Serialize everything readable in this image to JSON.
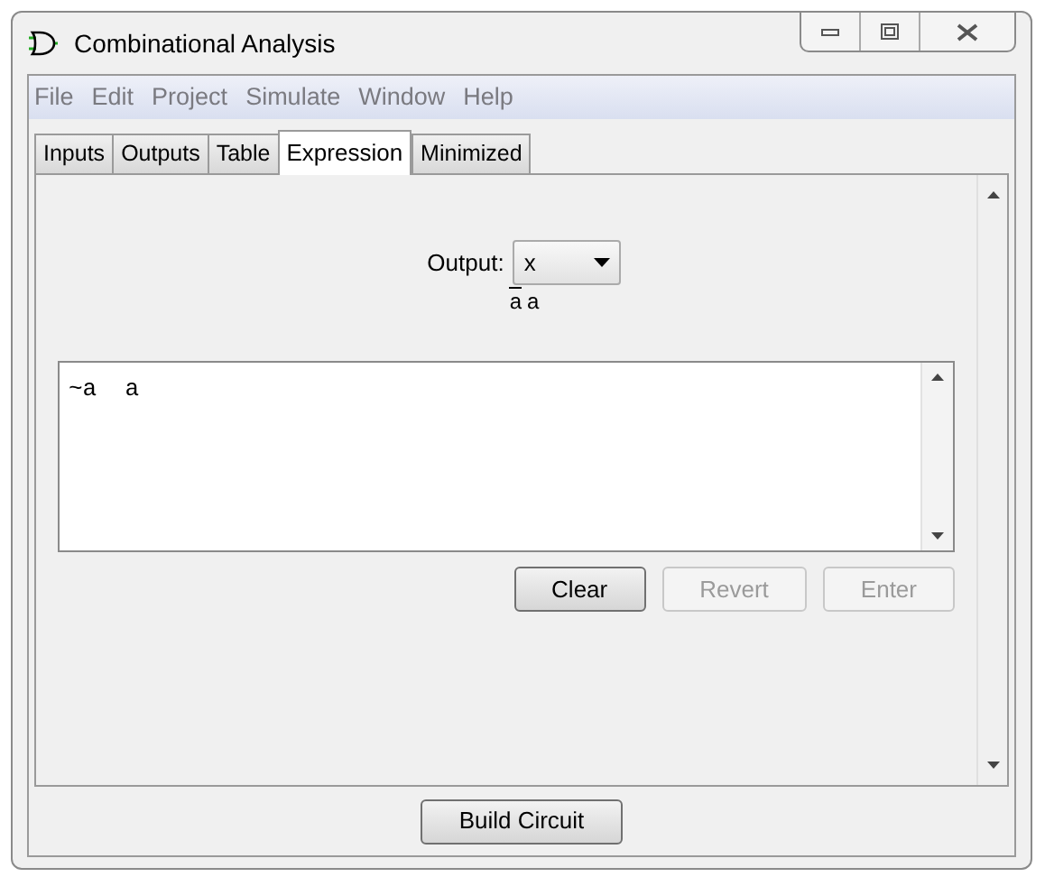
{
  "window": {
    "title": "Combinational Analysis"
  },
  "menu": [
    "File",
    "Edit",
    "Project",
    "Simulate",
    "Window",
    "Help"
  ],
  "tabs": [
    {
      "label": "Inputs",
      "selected": false
    },
    {
      "label": "Outputs",
      "selected": false
    },
    {
      "label": "Table",
      "selected": false
    },
    {
      "label": "Expression",
      "selected": true
    },
    {
      "label": "Minimized",
      "selected": false
    }
  ],
  "output": {
    "label": "Output:",
    "value": "x"
  },
  "expression_display": [
    {
      "text": "a",
      "negated": true
    },
    {
      "text": "a",
      "negated": false
    }
  ],
  "expression_field": {
    "value": "~a  a"
  },
  "buttons": [
    {
      "label": "Clear",
      "disabled": false
    },
    {
      "label": "Revert",
      "disabled": true
    },
    {
      "label": "Enter",
      "disabled": true
    }
  ],
  "footer_button": {
    "label": "Build Circuit"
  }
}
